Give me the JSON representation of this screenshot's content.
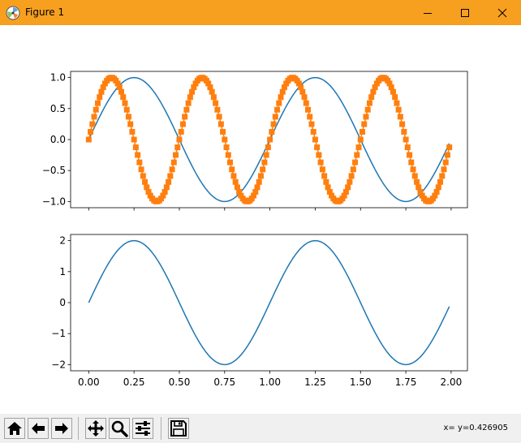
{
  "window": {
    "title": "Figure 1",
    "title_bar_color": "#f7a020"
  },
  "toolbar": {
    "buttons": [
      {
        "name": "home",
        "icon": "home-icon"
      },
      {
        "name": "back",
        "icon": "arrow-left-icon"
      },
      {
        "name": "forward",
        "icon": "arrow-right-icon"
      },
      {
        "name": "pan",
        "icon": "move-icon"
      },
      {
        "name": "zoom",
        "icon": "zoom-icon"
      },
      {
        "name": "configure-subplots",
        "icon": "sliders-icon"
      },
      {
        "name": "save",
        "icon": "save-icon"
      }
    ],
    "coordinates": "x= y=0.426905"
  },
  "chart_data": [
    {
      "type": "line",
      "title": "",
      "xlabel": "",
      "ylabel": "",
      "xlim": [
        -0.1,
        2.09
      ],
      "ylim": [
        -1.1,
        1.1
      ],
      "x_step": 0.01,
      "x_range": [
        0.0,
        1.99
      ],
      "yticks": [
        "−1.0",
        "−0.5",
        "0.0",
        "0.5",
        "1.0"
      ],
      "ytick_values": [
        -1.0,
        -0.5,
        0.0,
        0.5,
        1.0
      ],
      "xticks_labels_visible": false,
      "series": [
        {
          "function": "sin(2*pi*x)",
          "color": "#1f77b4",
          "marker": "none"
        },
        {
          "function": "sin(4*pi*x)",
          "color": "#ff7f0e",
          "marker": "square"
        }
      ]
    },
    {
      "type": "line",
      "title": "",
      "xlabel": "",
      "ylabel": "",
      "xlim": [
        -0.1,
        2.09
      ],
      "ylim": [
        -2.2,
        2.2
      ],
      "x_step": 0.01,
      "x_range": [
        0.0,
        1.99
      ],
      "xticks": [
        "0.00",
        "0.25",
        "0.50",
        "0.75",
        "1.00",
        "1.25",
        "1.50",
        "1.75",
        "2.00"
      ],
      "xtick_values": [
        0.0,
        0.25,
        0.5,
        0.75,
        1.0,
        1.25,
        1.5,
        1.75,
        2.0
      ],
      "yticks": [
        "−2",
        "−1",
        "0",
        "1",
        "2"
      ],
      "ytick_values": [
        -2,
        -1,
        0,
        1,
        2
      ],
      "series": [
        {
          "function": "2*sin(2*pi*x)",
          "color": "#1f77b4",
          "marker": "none"
        }
      ]
    }
  ]
}
